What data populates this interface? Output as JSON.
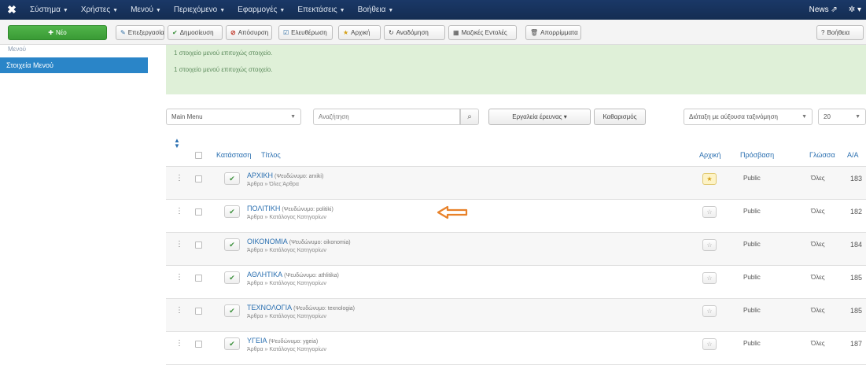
{
  "navbar": {
    "logo": "✖",
    "menus": [
      "Σύστημα",
      "Χρήστες",
      "Μενού",
      "Περιεχόμενο",
      "Εφαρμογές",
      "Επεκτάσεις",
      "Βοήθεια"
    ],
    "right_label": "News",
    "external_icon": "external-link-icon",
    "settings_icon": "gear-icon"
  },
  "toolbar": {
    "new": "Νέο",
    "edit": "Επεξεργασία",
    "publish": "Δημοσίευση",
    "unpublish": "Απόσυρση",
    "checkin": "Ελευθέρωση",
    "home": "Αρχική",
    "rebuild": "Αναδόμηση",
    "batch": "Μαζικές Εντολές",
    "trash": "Απορρίμματα",
    "help": "Βοήθεια"
  },
  "sidebar": {
    "top_link": "Μενού",
    "active": "Στοιχεία Μενού"
  },
  "messages": [
    "1 στοιχείο μενού επιτυχώς στοιχείο.",
    "1 στοιχείο μενού επιτυχώς στοιχείο."
  ],
  "filters": {
    "menu_select": "Main Menu",
    "search_placeholder": "Αναζήτηση",
    "search_tools": "Εργαλεία έρευνας",
    "clear": "Καθαρισμός",
    "ordering": "Διάταξη με αύξουσα ταξινόμηση",
    "limit": "20"
  },
  "table": {
    "headers": {
      "status": "Κατάσταση",
      "title": "Τίτλος",
      "home": "Αρχική",
      "access": "Πρόσβαση",
      "language": "Γλώσσα",
      "id": "A/A"
    },
    "rows": [
      {
        "title": "ΑΡΧΙΚΗ",
        "alias": "(Ψευδώνυμο: arxiki)",
        "sub": "Άρθρα » Όλες Άρθρα",
        "access": "Public",
        "language": "Όλες",
        "id": "183",
        "home": true
      },
      {
        "title": "ΠΟΛΙΤΙΚΗ",
        "alias": "(Ψευδώνυμο: politiki)",
        "sub": "Άρθρα » Κατάλογος Κατηγορίων",
        "access": "Public",
        "language": "Όλες",
        "id": "182",
        "home": false
      },
      {
        "title": "ΟΙΚΟΝΟΜΙΑ",
        "alias": "(Ψευδώνυμο: oikonomia)",
        "sub": "Άρθρα » Κατάλογος Κατηγορίων",
        "access": "Public",
        "language": "Όλες",
        "id": "184",
        "home": false
      },
      {
        "title": "ΑΘΛΗΤΙΚΑ",
        "alias": "(Ψευδώνυμο: athlitika)",
        "sub": "Άρθρα » Κατάλογος Κατηγορίων",
        "access": "Public",
        "language": "Όλες",
        "id": "185",
        "home": false
      },
      {
        "title": "ΤΕΧΝΟΛΟΓΙΑ",
        "alias": "(Ψευδώνυμο: texnologia)",
        "sub": "Άρθρα » Κατάλογος Κατηγορίων",
        "access": "Public",
        "language": "Όλες",
        "id": "185",
        "home": false
      },
      {
        "title": "ΥΓΕΙΑ",
        "alias": "(Ψευδώνυμο: ygeia)",
        "sub": "Άρθρα » Κατάλογος Κατηγορίων",
        "access": "Public",
        "language": "Όλες",
        "id": "187",
        "home": false
      }
    ]
  },
  "colors": {
    "navbar": "#1a3867",
    "new_button": "#46a93f",
    "active_sidebar": "#2a85c8",
    "message_bg": "#dff0d8",
    "link": "#2a6fb0",
    "arrow": "#e8822a"
  }
}
